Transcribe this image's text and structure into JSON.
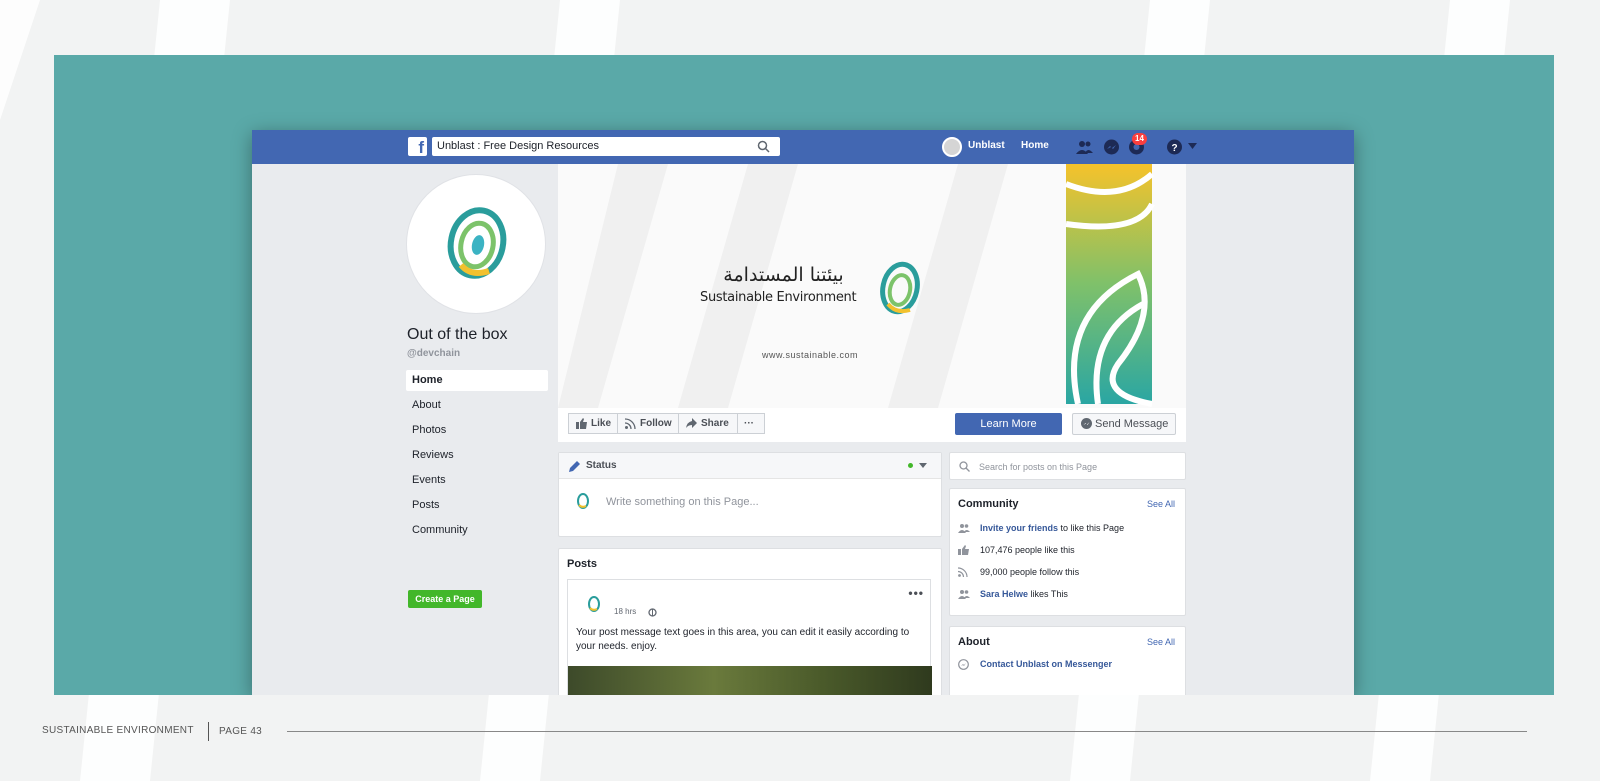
{
  "colors": {
    "frame": "#5aa9a8",
    "fb_blue": "#4267b2",
    "create_green": "#42b72a",
    "badge_red": "#fa3e3e",
    "link_blue": "#365899"
  },
  "topbar": {
    "logo_icon": "facebook-icon",
    "search_value": "Unblast : Free Design Resources",
    "user_name": "Unblast",
    "home_label": "Home",
    "notification_count": "14"
  },
  "sidebar": {
    "page_name": "Out of the box",
    "handle": "@devchain",
    "items": [
      {
        "label": "Home",
        "active": true
      },
      {
        "label": "About"
      },
      {
        "label": "Photos"
      },
      {
        "label": "Reviews"
      },
      {
        "label": "Events"
      },
      {
        "label": "Posts"
      },
      {
        "label": "Community"
      }
    ],
    "create_page_label": "Create a Page"
  },
  "cover": {
    "arabic_title": "بيئتنا المستدامة",
    "english_title": "Sustainable Environment",
    "url": "www.sustainable.com"
  },
  "actions": {
    "like": "Like",
    "follow": "Follow",
    "share": "Share",
    "more": "···",
    "learn_more": "Learn More",
    "send_message": "Send Message"
  },
  "composer": {
    "status_label": "Status",
    "placeholder": "Write something on this Page..."
  },
  "posts": {
    "heading": "Posts",
    "time": "18 hrs",
    "text": "Your post message text goes in this area, you can edit it easily according to your needs. enjoy."
  },
  "right": {
    "search_placeholder": "Search for posts on this Page",
    "community": {
      "title": "Community",
      "see_all": "See All",
      "invite_link": "Invite your friends",
      "invite_rest": " to like this Page",
      "likes": "107,476 people like this",
      "follows": "99,000 people follow this",
      "friend_link": "Sara Helwe",
      "friend_rest": " likes This"
    },
    "about": {
      "title": "About",
      "see_all": "See All",
      "messenger": "Contact Unblast on Messenger"
    }
  },
  "footer": {
    "left": "SUSTAINABLE ENVIRONMENT",
    "page": "PAGE 43"
  }
}
